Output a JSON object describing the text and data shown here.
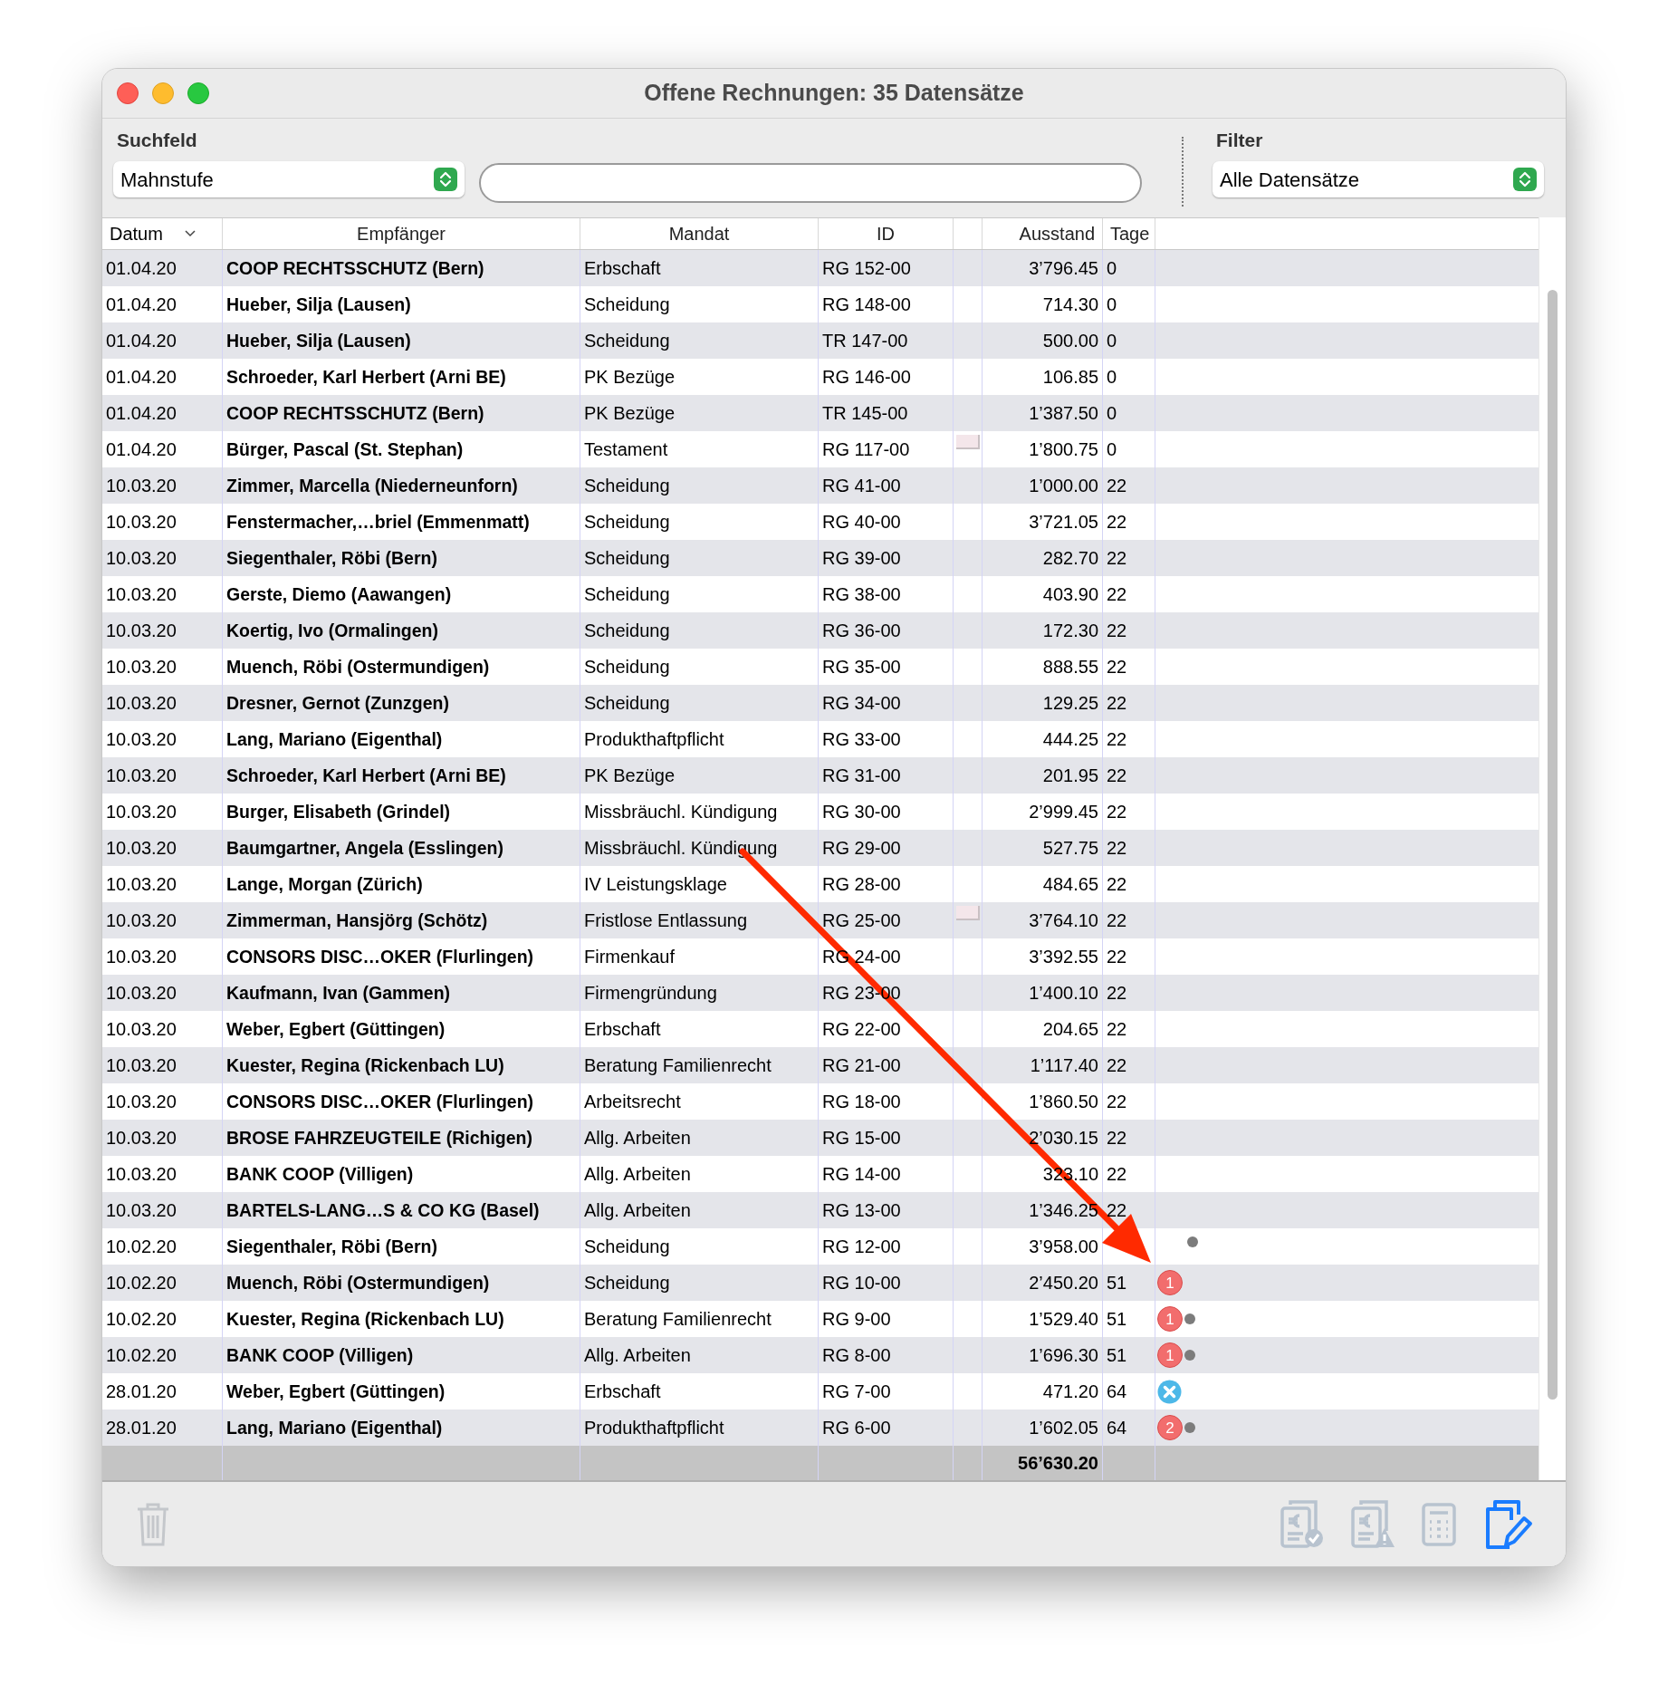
{
  "window": {
    "title": "Offene Rechnungen: 35 Datensätze"
  },
  "search": {
    "label": "Suchfeld",
    "field": "Mahnstufe"
  },
  "filter": {
    "label": "Filter",
    "value": "Alle Datensätze"
  },
  "columns": [
    {
      "label": "Datum",
      "sorted": true
    },
    {
      "label": "Empfänger",
      "sorted": false
    },
    {
      "label": "Mandat",
      "sorted": false
    },
    {
      "label": "ID",
      "sorted": false
    },
    {
      "label": "Ausstand",
      "sorted": false
    },
    {
      "label": "Tage",
      "sorted": false
    }
  ],
  "rows": [
    {
      "datum": "01.04.20",
      "empfaenger": "COOP RECHTSSCHUTZ (Bern)",
      "mandat": "Erbschaft",
      "id": "RG 152-00",
      "attachment": false,
      "ausstand": "3’796.45",
      "tage": "0",
      "dot": false,
      "cancelled": false
    },
    {
      "datum": "01.04.20",
      "empfaenger": "Hueber, Silja (Lausen)",
      "mandat": "Scheidung",
      "id": "RG 148-00",
      "attachment": false,
      "ausstand": "714.30",
      "tage": "0",
      "dot": false,
      "cancelled": false
    },
    {
      "datum": "01.04.20",
      "empfaenger": "Hueber, Silja (Lausen)",
      "mandat": "Scheidung",
      "id": "TR 147-00",
      "attachment": false,
      "ausstand": "500.00",
      "tage": "0",
      "dot": false,
      "cancelled": false
    },
    {
      "datum": "01.04.20",
      "empfaenger": "Schroeder, Karl Herbert (Arni BE)",
      "mandat": "PK Bezüge",
      "id": "RG 146-00",
      "attachment": false,
      "ausstand": "106.85",
      "tage": "0",
      "dot": false,
      "cancelled": false
    },
    {
      "datum": "01.04.20",
      "empfaenger": "COOP RECHTSSCHUTZ (Bern)",
      "mandat": "PK Bezüge",
      "id": "TR 145-00",
      "attachment": false,
      "ausstand": "1’387.50",
      "tage": "0",
      "dot": false,
      "cancelled": false
    },
    {
      "datum": "01.04.20",
      "empfaenger": "Bürger, Pascal (St. Stephan)",
      "mandat": "Testament",
      "id": "RG 117-00",
      "attachment": true,
      "ausstand": "1’800.75",
      "tage": "0",
      "dot": false,
      "cancelled": false
    },
    {
      "datum": "10.03.20",
      "empfaenger": "Zimmer, Marcella (Niederneunforn)",
      "mandat": "Scheidung",
      "id": "RG 41-00",
      "attachment": false,
      "ausstand": "1’000.00",
      "tage": "22",
      "dot": false,
      "cancelled": false
    },
    {
      "datum": "10.03.20",
      "empfaenger": "Fenstermacher,…briel (Emmenmatt)",
      "mandat": "Scheidung",
      "id": "RG 40-00",
      "attachment": false,
      "ausstand": "3’721.05",
      "tage": "22",
      "dot": false,
      "cancelled": false
    },
    {
      "datum": "10.03.20",
      "empfaenger": "Siegenthaler, Röbi (Bern)",
      "mandat": "Scheidung",
      "id": "RG 39-00",
      "attachment": false,
      "ausstand": "282.70",
      "tage": "22",
      "dot": false,
      "cancelled": false
    },
    {
      "datum": "10.03.20",
      "empfaenger": "Gerste, Diemo (Aawangen)",
      "mandat": "Scheidung",
      "id": "RG 38-00",
      "attachment": false,
      "ausstand": "403.90",
      "tage": "22",
      "dot": false,
      "cancelled": false
    },
    {
      "datum": "10.03.20",
      "empfaenger": "Koertig, Ivo (Ormalingen)",
      "mandat": "Scheidung",
      "id": "RG 36-00",
      "attachment": false,
      "ausstand": "172.30",
      "tage": "22",
      "dot": false,
      "cancelled": false
    },
    {
      "datum": "10.03.20",
      "empfaenger": "Muench, Röbi (Ostermundigen)",
      "mandat": "Scheidung",
      "id": "RG 35-00",
      "attachment": false,
      "ausstand": "888.55",
      "tage": "22",
      "dot": false,
      "cancelled": false
    },
    {
      "datum": "10.03.20",
      "empfaenger": "Dresner, Gernot (Zunzgen)",
      "mandat": "Scheidung",
      "id": "RG 34-00",
      "attachment": false,
      "ausstand": "129.25",
      "tage": "22",
      "dot": false,
      "cancelled": false
    },
    {
      "datum": "10.03.20",
      "empfaenger": "Lang, Mariano (Eigenthal)",
      "mandat": "Produkthaftpflicht",
      "id": "RG 33-00",
      "attachment": false,
      "ausstand": "444.25",
      "tage": "22",
      "dot": false,
      "cancelled": false
    },
    {
      "datum": "10.03.20",
      "empfaenger": "Schroeder, Karl Herbert (Arni BE)",
      "mandat": "PK Bezüge",
      "id": "RG 31-00",
      "attachment": false,
      "ausstand": "201.95",
      "tage": "22",
      "dot": false,
      "cancelled": false
    },
    {
      "datum": "10.03.20",
      "empfaenger": "Burger, Elisabeth (Grindel)",
      "mandat": "Missbräuchl. Kündigung",
      "id": "RG 30-00",
      "attachment": false,
      "ausstand": "2’999.45",
      "tage": "22",
      "dot": false,
      "cancelled": false
    },
    {
      "datum": "10.03.20",
      "empfaenger": "Baumgartner, Angela (Esslingen)",
      "mandat": "Missbräuchl. Kündigung",
      "id": "RG 29-00",
      "attachment": false,
      "ausstand": "527.75",
      "tage": "22",
      "dot": false,
      "cancelled": false
    },
    {
      "datum": "10.03.20",
      "empfaenger": "Lange, Morgan (Zürich)",
      "mandat": "IV Leistungsklage",
      "id": "RG 28-00",
      "attachment": false,
      "ausstand": "484.65",
      "tage": "22",
      "dot": false,
      "cancelled": false
    },
    {
      "datum": "10.03.20",
      "empfaenger": "Zimmerman, Hansjörg (Schötz)",
      "mandat": "Fristlose Entlassung",
      "id": "RG 25-00",
      "attachment": true,
      "ausstand": "3’764.10",
      "tage": "22",
      "dot": false,
      "cancelled": false
    },
    {
      "datum": "10.03.20",
      "empfaenger": "CONSORS DISC…OKER (Flurlingen)",
      "mandat": "Firmenkauf",
      "id": "RG 24-00",
      "attachment": false,
      "ausstand": "3’392.55",
      "tage": "22",
      "dot": false,
      "cancelled": false
    },
    {
      "datum": "10.03.20",
      "empfaenger": "Kaufmann, Ivan (Gammen)",
      "mandat": "Firmengründung",
      "id": "RG 23-00",
      "attachment": false,
      "ausstand": "1’400.10",
      "tage": "22",
      "dot": false,
      "cancelled": false
    },
    {
      "datum": "10.03.20",
      "empfaenger": "Weber, Egbert (Güttingen)",
      "mandat": "Erbschaft",
      "id": "RG 22-00",
      "attachment": false,
      "ausstand": "204.65",
      "tage": "22",
      "dot": false,
      "cancelled": false
    },
    {
      "datum": "10.03.20",
      "empfaenger": "Kuester, Regina (Rickenbach LU)",
      "mandat": "Beratung Familienrecht",
      "id": "RG 21-00",
      "attachment": false,
      "ausstand": "1’117.40",
      "tage": "22",
      "dot": false,
      "cancelled": false
    },
    {
      "datum": "10.03.20",
      "empfaenger": "CONSORS DISC…OKER (Flurlingen)",
      "mandat": "Arbeitsrecht",
      "id": "RG 18-00",
      "attachment": false,
      "ausstand": "1’860.50",
      "tage": "22",
      "dot": false,
      "cancelled": false
    },
    {
      "datum": "10.03.20",
      "empfaenger": "BROSE FAHRZEUGTEILE (Richigen)",
      "mandat": "Allg. Arbeiten",
      "id": "RG 15-00",
      "attachment": false,
      "ausstand": "2’030.15",
      "tage": "22",
      "dot": false,
      "cancelled": false
    },
    {
      "datum": "10.03.20",
      "empfaenger": "BANK COOP (Villigen)",
      "mandat": "Allg. Arbeiten",
      "id": "RG 14-00",
      "attachment": false,
      "ausstand": "323.10",
      "tage": "22",
      "dot": false,
      "cancelled": false
    },
    {
      "datum": "10.03.20",
      "empfaenger": "BARTELS-LANG…S & CO KG (Basel)",
      "mandat": "Allg. Arbeiten",
      "id": "RG 13-00",
      "attachment": false,
      "ausstand": "1’346.25",
      "tage": "22",
      "dot": false,
      "cancelled": false
    },
    {
      "datum": "10.02.20",
      "empfaenger": "Siegenthaler, Röbi (Bern)",
      "mandat": "Scheidung",
      "id": "RG 12-00",
      "attachment": false,
      "ausstand": "3’958.00",
      "dot": true,
      "cancelled": false
    },
    {
      "datum": "10.02.20",
      "empfaenger": "Muench, Röbi (Ostermundigen)",
      "mandat": "Scheidung",
      "id": "RG 10-00",
      "attachment": false,
      "ausstand": "2’450.20",
      "tage": "51",
      "reminder": "1",
      "dot": false,
      "cancelled": false
    },
    {
      "datum": "10.02.20",
      "empfaenger": "Kuester, Regina (Rickenbach LU)",
      "mandat": "Beratung Familienrecht",
      "id": "RG 9-00",
      "attachment": false,
      "ausstand": "1’529.40",
      "tage": "51",
      "reminder": "1",
      "dot": true,
      "cancelled": false
    },
    {
      "datum": "10.02.20",
      "empfaenger": "BANK COOP (Villigen)",
      "mandat": "Allg. Arbeiten",
      "id": "RG 8-00",
      "attachment": false,
      "ausstand": "1’696.30",
      "tage": "51",
      "reminder": "1",
      "dot": true,
      "cancelled": false
    },
    {
      "datum": "28.01.20",
      "empfaenger": "Weber, Egbert (Güttingen)",
      "mandat": "Erbschaft",
      "id": "RG 7-00",
      "attachment": false,
      "ausstand": "471.20",
      "tage": "64",
      "dot": false,
      "cancelled": true
    },
    {
      "datum": "28.01.20",
      "empfaenger": "Lang, Mariano (Eigenthal)",
      "mandat": "Produkthaftpflicht",
      "id": "RG 6-00",
      "attachment": false,
      "ausstand": "1’602.05",
      "tage": "64",
      "reminder": "2",
      "dot": true,
      "cancelled": false
    }
  ],
  "total": "56’630.20",
  "toolbar": [
    {
      "kind": "delete",
      "disabled": true
    },
    {
      "kind": "paid",
      "disabled": true
    },
    {
      "kind": "reminder",
      "disabled": true
    },
    {
      "kind": "calculator",
      "disabled": true
    },
    {
      "kind": "edit",
      "disabled": false
    }
  ]
}
